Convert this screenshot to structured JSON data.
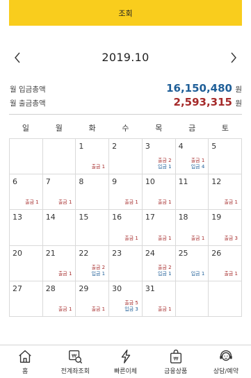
{
  "header": {
    "button_label": "조회"
  },
  "month_nav": {
    "title": "2019.10"
  },
  "summary": {
    "deposit_label": "월 입금총액",
    "deposit_amount": "16,150,480",
    "withdraw_label": "월 출금총액",
    "withdraw_amount": "2,593,315",
    "unit": "원"
  },
  "colors": {
    "accent": "#f9cd1d",
    "deposit": "#1f5f98",
    "withdraw": "#a52a2a"
  },
  "weekdays": [
    "일",
    "월",
    "화",
    "수",
    "목",
    "금",
    "토"
  ],
  "calendar": {
    "weeks": [
      [
        {
          "day": "",
          "tx": []
        },
        {
          "day": "",
          "tx": []
        },
        {
          "day": "1",
          "tx": [
            {
              "type": "out",
              "text": "출금 1"
            }
          ]
        },
        {
          "day": "2",
          "tx": []
        },
        {
          "day": "3",
          "tx": [
            {
              "type": "out",
              "text": "출금 2"
            },
            {
              "type": "in",
              "text": "입금 1"
            }
          ]
        },
        {
          "day": "4",
          "tx": [
            {
              "type": "out",
              "text": "출금 1"
            },
            {
              "type": "in",
              "text": "입금 4"
            }
          ]
        },
        {
          "day": "5",
          "tx": []
        }
      ],
      [
        {
          "day": "6",
          "tx": [
            {
              "type": "out",
              "text": "출금 1"
            }
          ]
        },
        {
          "day": "7",
          "tx": [
            {
              "type": "out",
              "text": "출금 1"
            }
          ]
        },
        {
          "day": "8",
          "tx": []
        },
        {
          "day": "9",
          "tx": [
            {
              "type": "out",
              "text": "출금 1"
            }
          ]
        },
        {
          "day": "10",
          "tx": [
            {
              "type": "out",
              "text": "출금 1"
            }
          ]
        },
        {
          "day": "11",
          "tx": []
        },
        {
          "day": "12",
          "tx": [
            {
              "type": "out",
              "text": "출금 1"
            }
          ]
        }
      ],
      [
        {
          "day": "13",
          "tx": []
        },
        {
          "day": "14",
          "tx": []
        },
        {
          "day": "15",
          "tx": []
        },
        {
          "day": "16",
          "tx": [
            {
              "type": "out",
              "text": "출금 1"
            }
          ]
        },
        {
          "day": "17",
          "tx": [
            {
              "type": "out",
              "text": "출금 1"
            }
          ]
        },
        {
          "day": "18",
          "tx": [
            {
              "type": "out",
              "text": "출금 1"
            }
          ]
        },
        {
          "day": "19",
          "tx": [
            {
              "type": "out",
              "text": "출금 3"
            }
          ]
        }
      ],
      [
        {
          "day": "20",
          "tx": []
        },
        {
          "day": "21",
          "tx": [
            {
              "type": "out",
              "text": "출금 1"
            }
          ]
        },
        {
          "day": "22",
          "tx": [
            {
              "type": "out",
              "text": "출금 2"
            },
            {
              "type": "in",
              "text": "입금 1"
            }
          ]
        },
        {
          "day": "23",
          "tx": []
        },
        {
          "day": "24",
          "tx": [
            {
              "type": "out",
              "text": "출금 2"
            },
            {
              "type": "in",
              "text": "입금 1"
            }
          ]
        },
        {
          "day": "25",
          "tx": [
            {
              "type": "in",
              "text": "입금 1"
            }
          ]
        },
        {
          "day": "26",
          "tx": [
            {
              "type": "out",
              "text": "출금 1"
            }
          ]
        }
      ],
      [
        {
          "day": "27",
          "tx": []
        },
        {
          "day": "28",
          "tx": [
            {
              "type": "out",
              "text": "출금 1"
            }
          ]
        },
        {
          "day": "29",
          "tx": [
            {
              "type": "out",
              "text": "출금 1"
            }
          ]
        },
        {
          "day": "30",
          "tx": [
            {
              "type": "out",
              "text": "출금 5"
            },
            {
              "type": "in",
              "text": "입금 3"
            }
          ]
        },
        {
          "day": "31",
          "tx": [
            {
              "type": "out",
              "text": "출금 1"
            }
          ]
        },
        {
          "day": "",
          "tx": []
        },
        {
          "day": "",
          "tx": []
        }
      ]
    ]
  },
  "tabbar": {
    "items": [
      {
        "label": "홈",
        "icon": "home-icon"
      },
      {
        "label": "전계좌조회",
        "icon": "account-search-icon"
      },
      {
        "label": "빠른이체",
        "icon": "lightning-icon"
      },
      {
        "label": "금융상품",
        "icon": "product-bag-icon"
      },
      {
        "label": "상담/예약",
        "icon": "headset-icon"
      }
    ]
  }
}
